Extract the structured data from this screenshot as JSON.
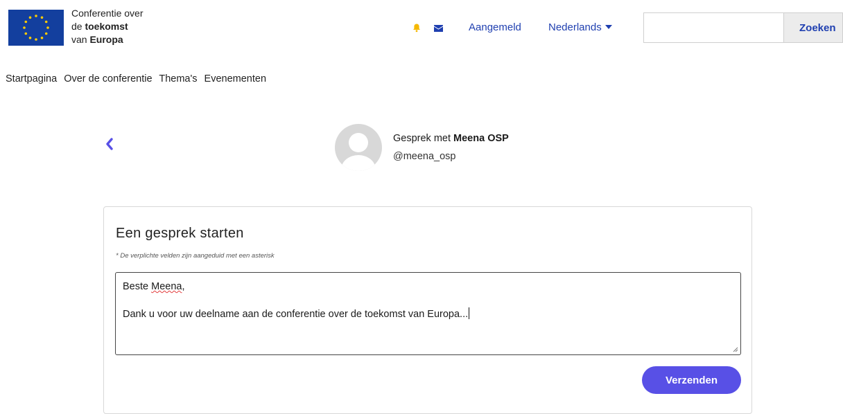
{
  "header": {
    "brand_line1": "Conferentie over",
    "brand_line2_prefix": "de ",
    "brand_line2_bold": "toekomst",
    "brand_line3_prefix": "van ",
    "brand_line3_bold": "Europa",
    "signed_in_label": "Aangemeld",
    "language_label": "Nederlands",
    "search_value": "",
    "search_button_label": "Zoeken",
    "icons": [
      "eu-flag-logo",
      "bell-icon",
      "mail-icon",
      "caret-down-icon"
    ]
  },
  "nav": {
    "items": [
      "Startpagina",
      "Over de conferentie",
      "Thema's",
      "Evenementen"
    ]
  },
  "conversation": {
    "title_prefix": "Gesprek met ",
    "recipient_name": "Meena OSP",
    "recipient_handle": "@meena_osp",
    "icons": [
      "chevron-left-icon",
      "avatar-placeholder"
    ]
  },
  "form": {
    "title": "Een gesprek starten",
    "required_note": "* De verplichte velden zijn aangeduid met een asterisk",
    "message_greeting_prefix": "Beste ",
    "message_greeting_name": "Meena",
    "message_greeting_suffix": ",",
    "message_body": "Dank u voor uw deelname aan de conferentie over de toekomst van Europa...",
    "send_label": "Verzenden"
  },
  "colors": {
    "link_blue": "#1f3fb0",
    "accent_purple": "#5850e6",
    "bell_yellow": "#f5b800",
    "eu_blue": "#133f9e",
    "eu_star": "#ffcc00"
  }
}
